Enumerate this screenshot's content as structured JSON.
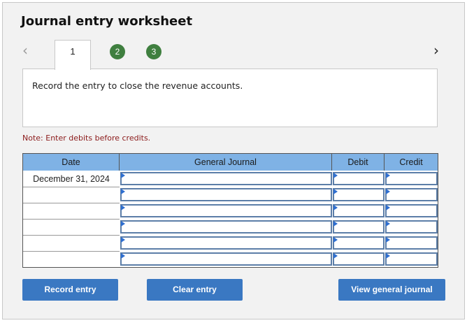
{
  "title": "Journal entry worksheet",
  "nav": {
    "prev_icon": "chevron-left-icon",
    "next_icon": "chevron-right-icon"
  },
  "tabs": [
    {
      "label": "1",
      "active": true
    },
    {
      "label": "2",
      "active": false
    },
    {
      "label": "3",
      "active": false
    }
  ],
  "instruction": "Record the entry to close the revenue accounts.",
  "note": "Note: Enter debits before credits.",
  "table": {
    "headers": {
      "date": "Date",
      "general_journal": "General Journal",
      "debit": "Debit",
      "credit": "Credit"
    },
    "rows": [
      {
        "date": "December 31, 2024",
        "account": "",
        "debit": "",
        "credit": ""
      },
      {
        "date": "",
        "account": "",
        "debit": "",
        "credit": ""
      },
      {
        "date": "",
        "account": "",
        "debit": "",
        "credit": ""
      },
      {
        "date": "",
        "account": "",
        "debit": "",
        "credit": ""
      },
      {
        "date": "",
        "account": "",
        "debit": "",
        "credit": ""
      },
      {
        "date": "",
        "account": "",
        "debit": "",
        "credit": ""
      }
    ]
  },
  "buttons": {
    "record": "Record entry",
    "clear": "Clear entry",
    "view": "View general journal"
  },
  "colors": {
    "header_bg": "#7fb2e5",
    "button_bg": "#3a78c2",
    "tab_circle": "#3f7f3f",
    "note_text": "#8b1a1a"
  }
}
